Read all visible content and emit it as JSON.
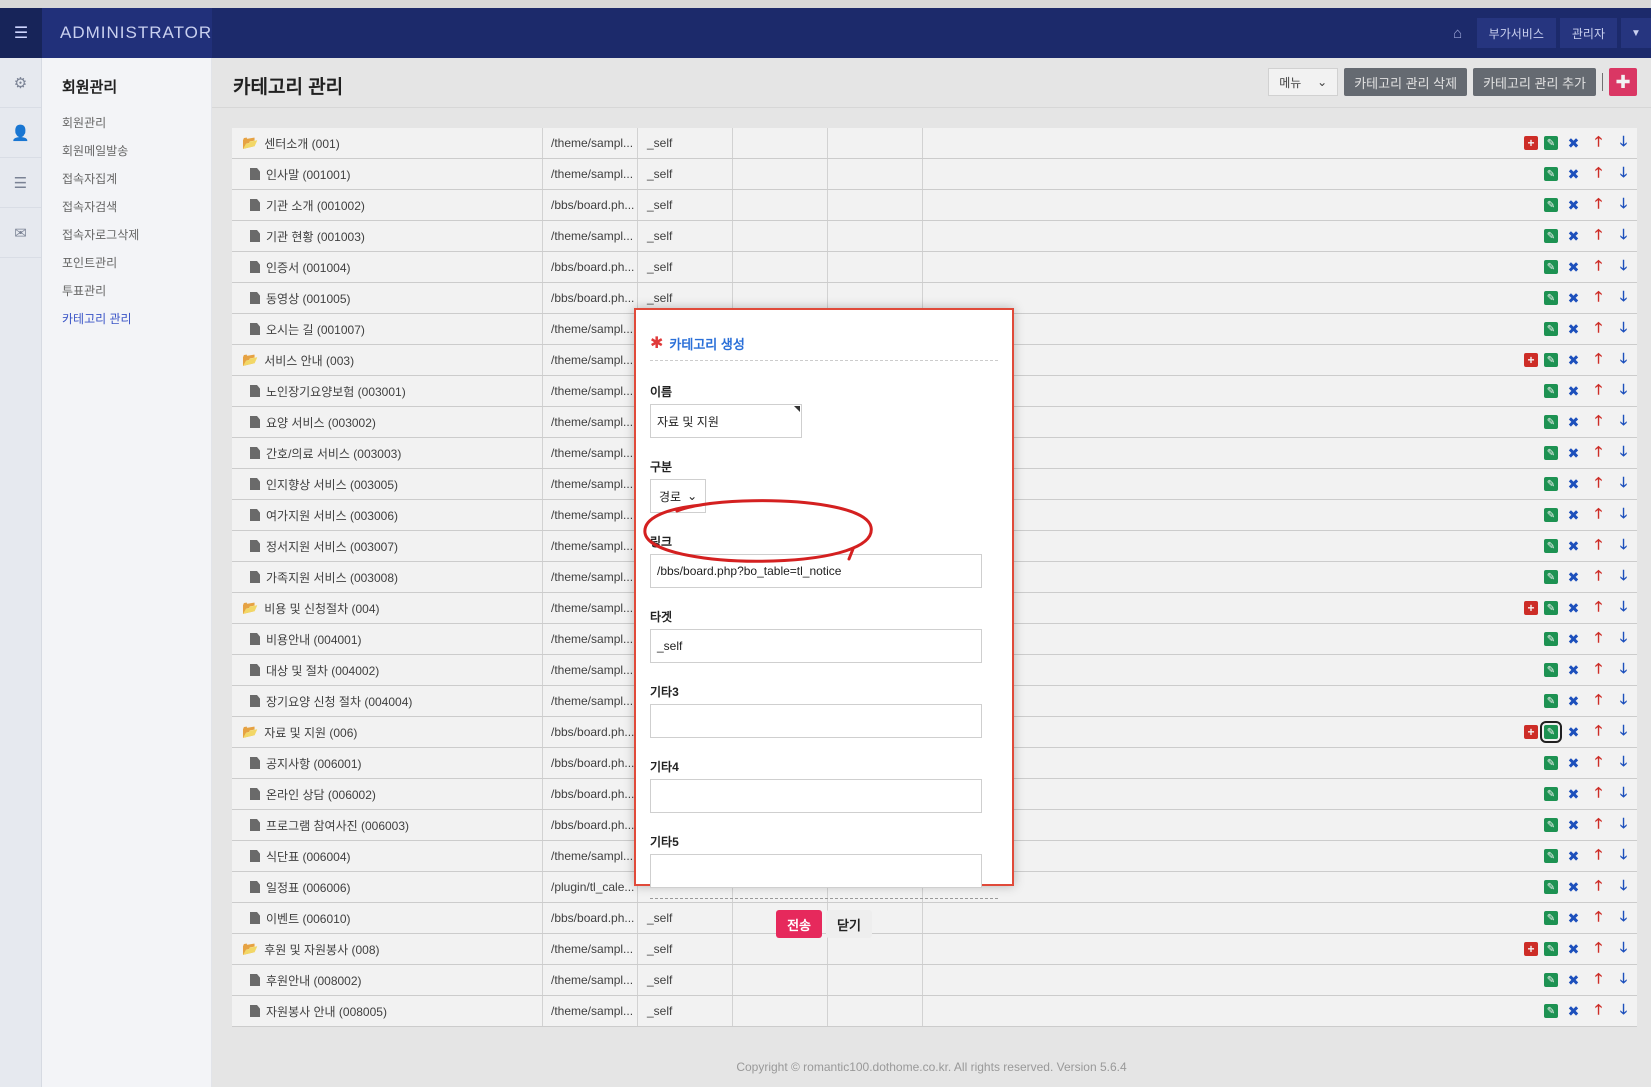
{
  "header": {
    "brand": "ADMINISTRATOR",
    "service_label": "부가서비스",
    "admin_label": "관리자"
  },
  "sidebar": {
    "section_title": "회원관리",
    "items": [
      "회원관리",
      "회원메일발송",
      "접속자집계",
      "접속자검색",
      "접속자로그삭제",
      "포인트관리",
      "투표관리",
      "카테고리 관리"
    ],
    "active_index": 7
  },
  "page": {
    "title": "카테고리 관리",
    "menu_select": "메뉴",
    "delete_btn": "카테고리 관리 삭제",
    "add_btn": "카테고리 관리 추가",
    "plus_btn": "✚"
  },
  "categories": [
    {
      "name": "센터소개 (001)",
      "link": "/theme/sampl...",
      "target": "_self",
      "folder": true
    },
    {
      "name": "인사말 (001001)",
      "link": "/theme/sampl...",
      "target": "_self",
      "folder": false
    },
    {
      "name": "기관 소개 (001002)",
      "link": "/bbs/board.ph...",
      "target": "_self",
      "folder": false
    },
    {
      "name": "기관 현황 (001003)",
      "link": "/theme/sampl...",
      "target": "_self",
      "folder": false
    },
    {
      "name": "인증서 (001004)",
      "link": "/bbs/board.ph...",
      "target": "_self",
      "folder": false
    },
    {
      "name": "동영상 (001005)",
      "link": "/bbs/board.ph...",
      "target": "_self",
      "folder": false
    },
    {
      "name": "오시는 길 (001007)",
      "link": "/theme/sampl...",
      "target": "",
      "folder": false
    },
    {
      "name": "서비스 안내 (003)",
      "link": "/theme/sampl...",
      "target": "",
      "folder": true
    },
    {
      "name": "노인장기요양보험 (003001)",
      "link": "/theme/sampl...",
      "target": "",
      "folder": false
    },
    {
      "name": "요양 서비스 (003002)",
      "link": "/theme/sampl...",
      "target": "",
      "folder": false
    },
    {
      "name": "간호/의료 서비스 (003003)",
      "link": "/theme/sampl...",
      "target": "",
      "folder": false
    },
    {
      "name": "인지향상 서비스 (003005)",
      "link": "/theme/sampl...",
      "target": "",
      "folder": false
    },
    {
      "name": "여가지원 서비스 (003006)",
      "link": "/theme/sampl...",
      "target": "",
      "folder": false
    },
    {
      "name": "정서지원 서비스 (003007)",
      "link": "/theme/sampl...",
      "target": "",
      "folder": false
    },
    {
      "name": "가족지원 서비스 (003008)",
      "link": "/theme/sampl...",
      "target": "",
      "folder": false
    },
    {
      "name": "비용 및 신청절차 (004)",
      "link": "/theme/sampl...",
      "target": "",
      "folder": true
    },
    {
      "name": "비용안내 (004001)",
      "link": "/theme/sampl...",
      "target": "",
      "folder": false
    },
    {
      "name": "대상 및 절차 (004002)",
      "link": "/theme/sampl...",
      "target": "",
      "folder": false
    },
    {
      "name": "장기요양 신청 절차 (004004)",
      "link": "/theme/sampl...",
      "target": "",
      "folder": false
    },
    {
      "name": "자료 및 지원 (006)",
      "link": "/bbs/board.ph...",
      "target": "",
      "folder": true
    },
    {
      "name": "공지사항 (006001)",
      "link": "/bbs/board.ph...",
      "target": "",
      "folder": false
    },
    {
      "name": "온라인 상담 (006002)",
      "link": "/bbs/board.ph...",
      "target": "",
      "folder": false
    },
    {
      "name": "프로그램 참여사진 (006003)",
      "link": "/bbs/board.ph...",
      "target": "",
      "folder": false
    },
    {
      "name": "식단표 (006004)",
      "link": "/theme/sampl...",
      "target": "",
      "folder": false
    },
    {
      "name": "일정표 (006006)",
      "link": "/plugin/tl_cale...",
      "target": "",
      "folder": false
    },
    {
      "name": "이벤트 (006010)",
      "link": "/bbs/board.ph...",
      "target": "_self",
      "folder": false
    },
    {
      "name": "후원 및 자원봉사 (008)",
      "link": "/theme/sampl...",
      "target": "_self",
      "folder": true
    },
    {
      "name": "후원안내 (008002)",
      "link": "/theme/sampl...",
      "target": "_self",
      "folder": false
    },
    {
      "name": "자원봉사 안내 (008005)",
      "link": "/theme/sampl...",
      "target": "_self",
      "folder": false
    }
  ],
  "footer": "Copyright © romantic100.dothome.co.kr. All rights reserved. Version 5.6.4",
  "modal": {
    "title": "카테고리 생성",
    "name_label": "이름",
    "name_value": "자료 및 지원",
    "type_label": "구분",
    "type_value": "경로",
    "link_label": "링크",
    "link_value": "/bbs/board.php?bo_table=tl_notice",
    "target_label": "타겟",
    "target_value": "_self",
    "etc3_label": "기타3",
    "etc4_label": "기타4",
    "etc5_label": "기타5",
    "submit_label": "전송",
    "close_label": "닫기"
  },
  "colors": {
    "header_bg": "#1c2a6b",
    "accent_pink": "#e6295c",
    "link_blue": "#2a6fd8",
    "annotation_red": "#d42020"
  }
}
